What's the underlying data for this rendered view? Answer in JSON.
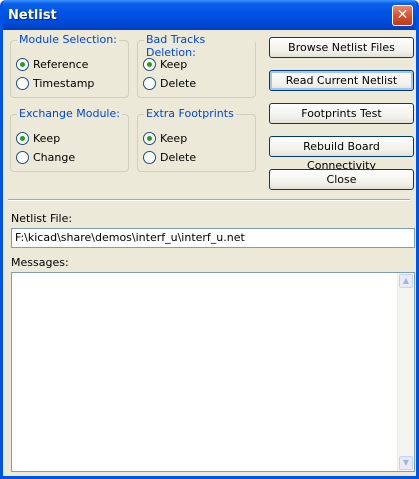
{
  "window": {
    "title": "Netlist",
    "close_glyph": "✕"
  },
  "groups": {
    "module_selection": {
      "title": "Module Selection:",
      "options": [
        {
          "label": "Reference",
          "checked": true
        },
        {
          "label": "Timestamp",
          "checked": false
        }
      ]
    },
    "bad_tracks_deletion": {
      "title": "Bad Tracks Deletion:",
      "options": [
        {
          "label": "Keep",
          "checked": true
        },
        {
          "label": "Delete",
          "checked": false
        }
      ]
    },
    "exchange_module": {
      "title": "Exchange Module:",
      "options": [
        {
          "label": "Keep",
          "checked": true
        },
        {
          "label": "Change",
          "checked": false
        }
      ]
    },
    "extra_footprints": {
      "title": "Extra Footprints",
      "options": [
        {
          "label": "Keep",
          "checked": true
        },
        {
          "label": "Delete",
          "checked": false
        }
      ]
    }
  },
  "buttons": {
    "browse": "Browse Netlist Files",
    "read": "Read Current Netlist",
    "footprints_test": "Footprints Test",
    "rebuild": "Rebuild Board Connectivity",
    "close": "Close"
  },
  "netlist_file": {
    "label": "Netlist File:",
    "value": "F:\\kicad\\share\\demos\\interf_u\\interf_u.net"
  },
  "messages": {
    "label": "Messages:",
    "value": ""
  },
  "icons": {
    "scroll_up": "scroll-up-arrow-icon",
    "scroll_down": "scroll-down-arrow-icon",
    "close": "close-icon"
  },
  "colors": {
    "title_bar": "#0054e3",
    "group_title": "#0046d5",
    "dialog_bg": "#ece9d8"
  }
}
